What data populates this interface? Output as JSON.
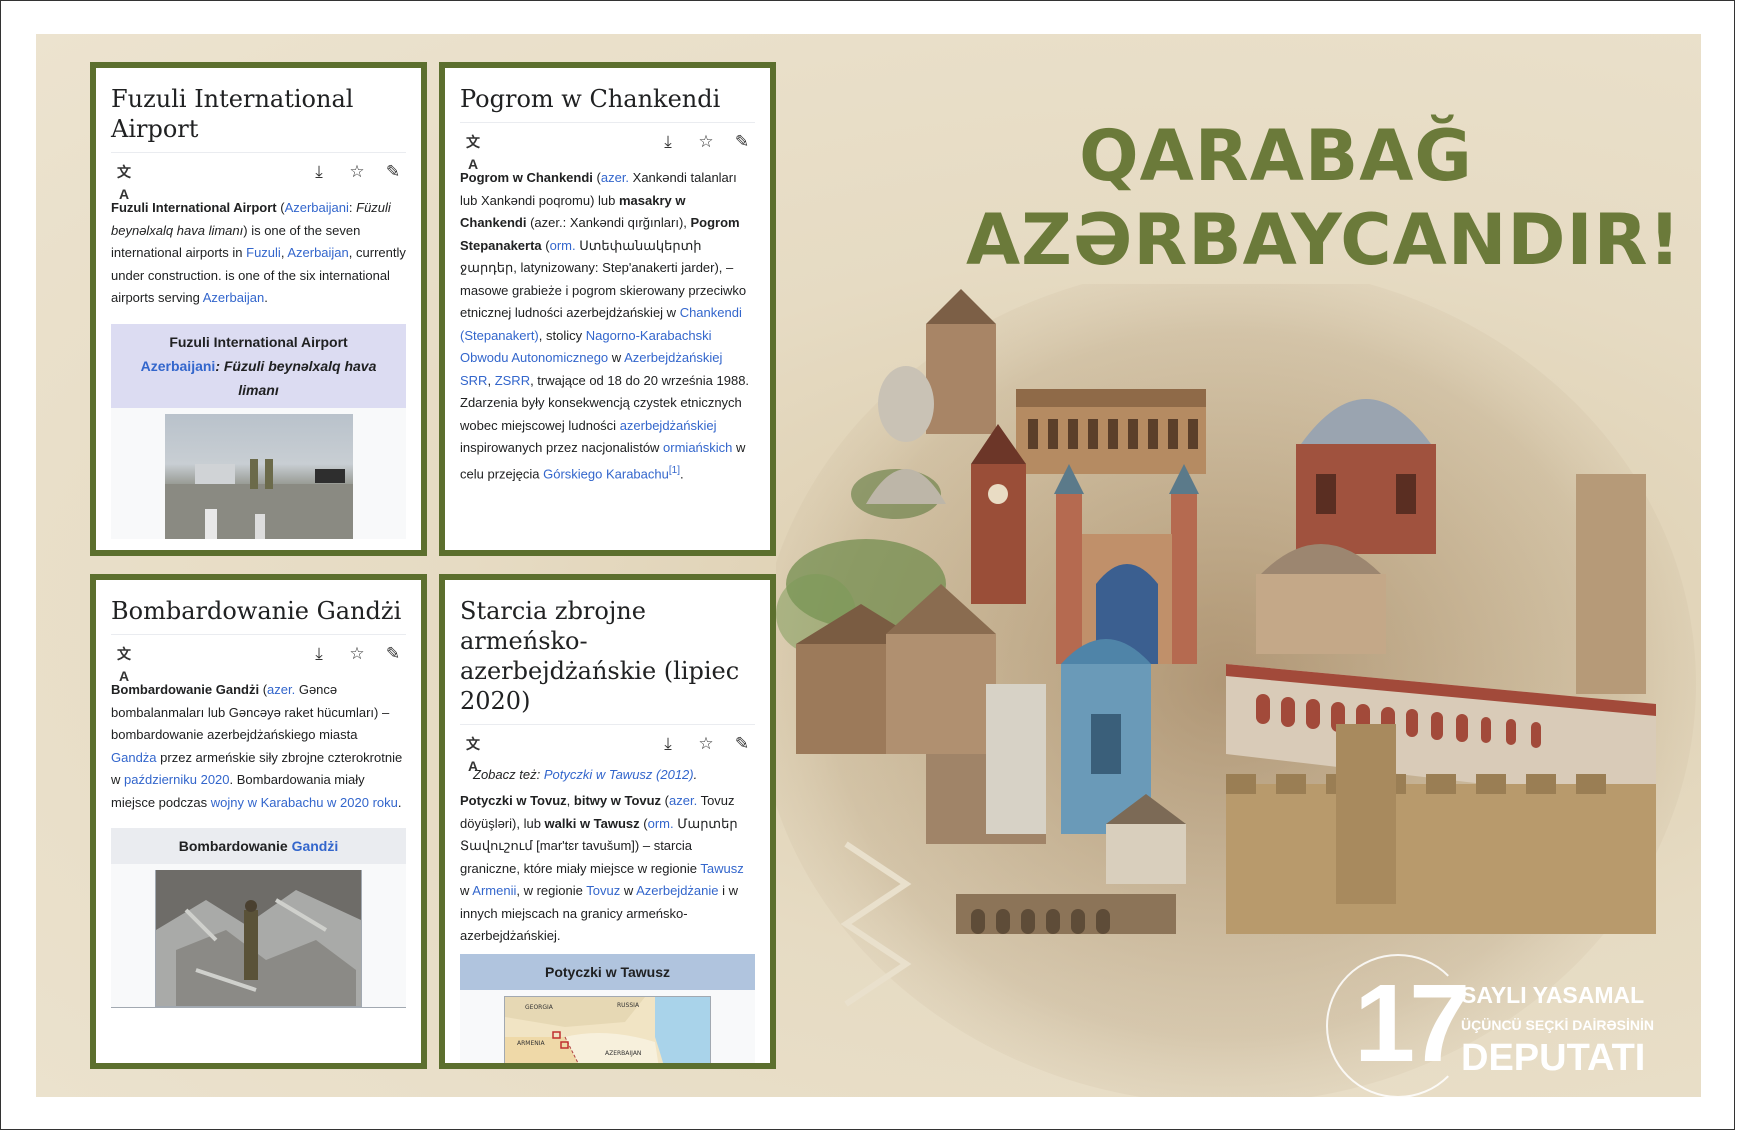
{
  "headline": {
    "line1": "QARABAĞ",
    "line2": "AZƏRBAYCANDIR!"
  },
  "badge": {
    "number": "17",
    "line1": "SAYLI YASAMAL",
    "line2": "ÜÇÜNCÜ SEÇKİ DAİRƏSİNİN",
    "line3": "DEPUTATI"
  },
  "colors": {
    "accent": "#5c6f2e",
    "headline": "#6b7a3a",
    "link": "#3366cc"
  },
  "icons": {
    "language": "translate-icon",
    "download": "download-icon",
    "star": "star-icon",
    "edit": "pencil-icon"
  },
  "card1": {
    "title": "Fuzuli International Airport",
    "p": [
      {
        "t": "Fuzuli International Airport",
        "b": true
      },
      {
        "t": " ("
      },
      {
        "t": "Azerbaijani",
        "link": true
      },
      {
        "t": ": "
      },
      {
        "t": "Füzuli beynəlxalq hava limanı",
        "i": true
      },
      {
        "t": ") is one of the seven international airports in "
      },
      {
        "t": "Fuzuli",
        "link": true
      },
      {
        "t": ", "
      },
      {
        "t": "Azerbaijan",
        "link": true
      },
      {
        "t": ", currently under construction. is one of the six international airports serving "
      },
      {
        "t": "Azerbaijan",
        "link": true
      },
      {
        "t": "."
      }
    ],
    "infobox_title": "Fuzuli International Airport",
    "infobox_sub_link": "Azerbaijani",
    "infobox_sub_text": ": Füzuli beynəlxalq hava limanı"
  },
  "card2": {
    "title": "Pogrom w Chankendi",
    "p": [
      {
        "t": "Pogrom w Chankendi",
        "b": true
      },
      {
        "t": " ("
      },
      {
        "t": "azer.",
        "link": true
      },
      {
        "t": " Xankəndi talanları lub Xankəndi poqromu) lub "
      },
      {
        "t": "masakry w Chankendi",
        "b": true
      },
      {
        "t": " (azer.: Xankəndi qırğınları), "
      },
      {
        "t": "Pogrom Stepanakerta",
        "b": true
      },
      {
        "t": " ("
      },
      {
        "t": "orm.",
        "link": true
      },
      {
        "t": " Ստեփանակերտի ջարդեր, latynizowany: Step'anakerti jarder), – masowe grabieże i pogrom skierowany przeciwko etnicznej ludności azerbejdżańskiej w "
      },
      {
        "t": "Chankendi (Stepanakert)",
        "link": true
      },
      {
        "t": ", stolicy "
      },
      {
        "t": "Nagorno-Karabachski Obwodu Autonomicznego",
        "link": true
      },
      {
        "t": " w "
      },
      {
        "t": "Azerbejdżańskiej SRR",
        "link": true
      },
      {
        "t": ", "
      },
      {
        "t": "ZSRR",
        "link": true
      },
      {
        "t": ", trwające od 18 do 20 września 1988. Zdarzenia były konsekwencją czystek etnicznych wobec miejscowej ludności "
      },
      {
        "t": "azerbejdżańskiej",
        "link": true
      },
      {
        "t": " inspirowanych przez nacjonalistów "
      },
      {
        "t": "ormiańskich",
        "link": true
      },
      {
        "t": " w celu przejęcia "
      },
      {
        "t": "Górskiego Karabachu",
        "link": true
      },
      {
        "t": "[1]",
        "link": true,
        "sup": true
      },
      {
        "t": "."
      }
    ]
  },
  "card3": {
    "title": "Bombardowanie Gandżi",
    "p": [
      {
        "t": "Bombardowanie Gandżi",
        "b": true
      },
      {
        "t": " ("
      },
      {
        "t": "azer.",
        "link": true
      },
      {
        "t": " Gəncə bombalanmaları lub Gəncəyə raket hücumları) – bombardowanie azerbejdżańskiego miasta "
      },
      {
        "t": "Gandża",
        "link": true
      },
      {
        "t": " przez armeńskie siły zbrojne czterokrotnie w "
      },
      {
        "t": "październiku 2020",
        "link": true
      },
      {
        "t": ". Bombardowania miały miejsce podczas "
      },
      {
        "t": "wojny w Karabachu w 2020 roku",
        "link": true
      },
      {
        "t": "."
      }
    ],
    "infobox_text": "Bombardowanie ",
    "infobox_link": "Gandżi"
  },
  "card4": {
    "title": "Starcia zbrojne armeńsko-azerbejdżańskie (lipiec 2020)",
    "see_also_label": "Zobacz też: ",
    "see_also_link": "Potyczki w Tawusz (2012)",
    "p": [
      {
        "t": "Potyczki w Tovuz",
        "b": true
      },
      {
        "t": ", "
      },
      {
        "t": "bitwy w Tovuz",
        "b": true
      },
      {
        "t": " ("
      },
      {
        "t": "azer.",
        "link": true
      },
      {
        "t": " Tovuz döyüşləri), lub "
      },
      {
        "t": "walki w Tawusz",
        "b": true
      },
      {
        "t": " ("
      },
      {
        "t": "orm.",
        "link": true
      },
      {
        "t": " Մարտեր Տավուշում [mar'tɛr tavušum]) – starcia graniczne, które miały miejsce w regionie "
      },
      {
        "t": "Tawusz",
        "link": true
      },
      {
        "t": " w "
      },
      {
        "t": "Armenii",
        "link": true
      },
      {
        "t": ", w regionie "
      },
      {
        "t": "Tovuz",
        "link": true
      },
      {
        "t": " w "
      },
      {
        "t": "Azerbejdżanie",
        "link": true
      },
      {
        "t": " i w innych miejscach na granicy armeńsko-azerbejdżańskiej."
      }
    ],
    "infobox_title": "Potyczki w Tawusz",
    "map_labels": {
      "georgia": "GEORGIA",
      "russia": "RUSSIA",
      "armenia": "ARMENIA",
      "azerbaijan": "AZERBAIJAN"
    }
  }
}
